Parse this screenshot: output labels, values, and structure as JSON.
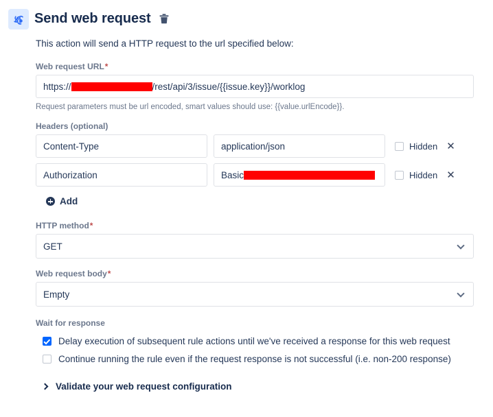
{
  "header": {
    "icon": "webhook-automation-icon",
    "title": "Send web request",
    "delete_icon": "trash-icon",
    "icon_bg": "#deebff",
    "icon_color": "#2f6df6"
  },
  "description": "This action will send a HTTP request to the url specified below:",
  "url_field": {
    "label": "Web request URL",
    "required_marker": "*",
    "value_prefix": "https://",
    "value_redacted": true,
    "value_suffix": "/rest/api/3/issue/{{issue.key}}/worklog",
    "helper": "Request parameters must be url encoded, smart values should use: {{value.urlEncode}}."
  },
  "headers_section": {
    "label": "Headers (optional)",
    "hidden_label": "Hidden",
    "remove_icon": "close-x-icon",
    "rows": [
      {
        "key": "Content-Type",
        "value": "application/json",
        "value_redacted": false,
        "hidden_checked": false
      },
      {
        "key": "Authorization",
        "value": "Basic ",
        "value_redacted": true,
        "hidden_checked": false
      }
    ],
    "add_label": "Add",
    "add_icon": "plus-circle-icon"
  },
  "http_method": {
    "label": "HTTP method",
    "required_marker": "*",
    "value": "GET",
    "chevron_icon": "chevron-down-icon"
  },
  "request_body": {
    "label": "Web request body",
    "required_marker": "*",
    "value": "Empty",
    "chevron_icon": "chevron-down-icon"
  },
  "wait_for_response": {
    "label": "Wait for response",
    "options": [
      {
        "text": "Delay execution of subsequent rule actions until we've received a response for this web request",
        "checked": true
      },
      {
        "text": "Continue running the rule even if the request response is not successful (i.e. non-200 response)",
        "checked": false
      }
    ]
  },
  "validate": {
    "chevron_icon": "chevron-right-icon",
    "text": "Validate your web request configuration"
  },
  "colors": {
    "accent": "#0065ff",
    "text_dark": "#172b4d",
    "text_body": "#253858",
    "text_muted": "#6b778c",
    "border": "#dfe1e6",
    "redaction": "#ff0000",
    "required": "#bf4d4d"
  }
}
